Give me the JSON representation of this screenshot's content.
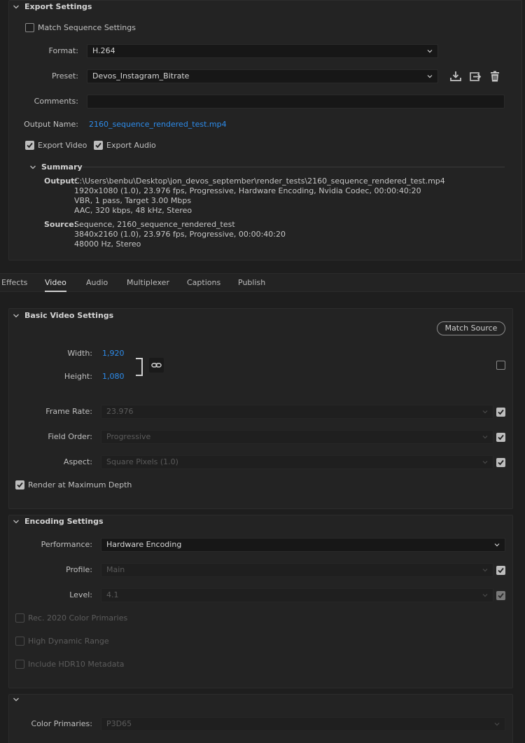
{
  "export_settings": {
    "title": "Export Settings",
    "match_sequence_label": "Match Sequence Settings",
    "match_sequence_checked": false,
    "format_label": "Format:",
    "format_value": "H.264",
    "preset_label": "Preset:",
    "preset_value": "Devos_Instagram_Bitrate",
    "comments_label": "Comments:",
    "comments_value": "",
    "output_name_label": "Output Name:",
    "output_name_value": "2160_sequence_rendered_test.mp4",
    "export_video_label": "Export Video",
    "export_video_checked": true,
    "export_audio_label": "Export Audio",
    "export_audio_checked": true,
    "icons": [
      "save-preset-icon",
      "import-preset-icon",
      "delete-preset-icon"
    ]
  },
  "summary": {
    "title": "Summary",
    "output_label": "Output:",
    "output_lines": [
      "C:\\Users\\benbu\\Desktop\\jon_devos_september\\render_tests\\2160_sequence_rendered_test.mp4",
      "1920x1080 (1.0), 23.976 fps, Progressive, Hardware Encoding, Nvidia Codec, 00:00:40:20",
      "VBR, 1 pass, Target 3.00 Mbps",
      "AAC, 320 kbps, 48 kHz, Stereo"
    ],
    "source_label": "Source:",
    "source_lines": [
      "Sequence, 2160_sequence_rendered_test",
      "3840x2160 (1.0), 23.976 fps, Progressive, 00:00:40:20",
      "48000 Hz, Stereo"
    ]
  },
  "tabs": [
    {
      "label": "Effects",
      "active": false
    },
    {
      "label": "Video",
      "active": true
    },
    {
      "label": "Audio",
      "active": false
    },
    {
      "label": "Multiplexer",
      "active": false
    },
    {
      "label": "Captions",
      "active": false
    },
    {
      "label": "Publish",
      "active": false
    }
  ],
  "basic_video": {
    "title": "Basic Video Settings",
    "match_source_label": "Match Source",
    "width_label": "Width:",
    "width_value": "1,920",
    "height_label": "Height:",
    "height_value": "1,080",
    "frame_rate_label": "Frame Rate:",
    "frame_rate_value": "23.976",
    "field_order_label": "Field Order:",
    "field_order_value": "Progressive",
    "aspect_label": "Aspect:",
    "aspect_value": "Square Pixels (1.0)",
    "render_max_depth_label": "Render at Maximum Depth",
    "render_max_depth_checked": true
  },
  "encoding": {
    "title": "Encoding Settings",
    "performance_label": "Performance:",
    "performance_value": "Hardware Encoding",
    "profile_label": "Profile:",
    "profile_value": "Main",
    "level_label": "Level:",
    "level_value": "4.1",
    "rec2020_label": "Rec. 2020 Color Primaries",
    "hdr_label": "High Dynamic Range",
    "hdr10_label": "Include HDR10 Metadata"
  },
  "color": {
    "primaries_label": "Color Primaries:",
    "primaries_value": "P3D65"
  },
  "colors": {
    "link": "#2d8ceb",
    "background": "#1e1e1e",
    "panel": "#232323"
  }
}
